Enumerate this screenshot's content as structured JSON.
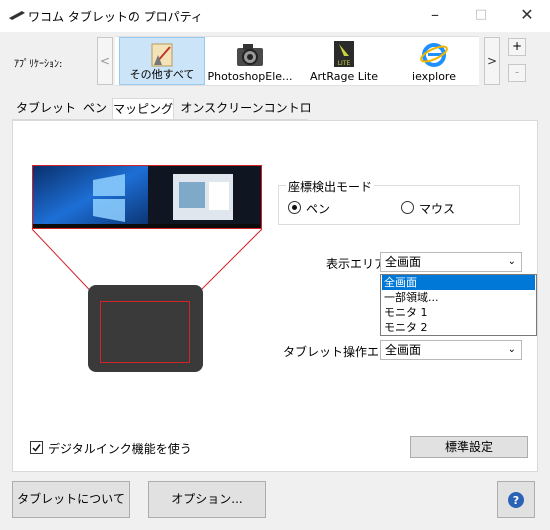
{
  "window": {
    "title": "ワコム タブレットの プロパティ"
  },
  "controls": {
    "minimize": "–",
    "maximize": "□",
    "close": "✕"
  },
  "apps": {
    "label": "ｱﾌﾟﾘｹｰｼｮﾝ:",
    "prev": "<",
    "next": ">",
    "add": "+",
    "remove": "-",
    "items": [
      {
        "label": "その他すべて",
        "icon": "all-apps-icon",
        "selected": true
      },
      {
        "label": "PhotoshopEle...",
        "icon": "photoshop-elements-icon",
        "selected": false
      },
      {
        "label": "ArtRage Lite",
        "icon": "artrage-lite-icon",
        "selected": false
      },
      {
        "label": "iexplore",
        "icon": "internet-explorer-icon",
        "selected": false
      }
    ]
  },
  "tabs": [
    {
      "label": "タブレット",
      "active": false
    },
    {
      "label": "ペン",
      "active": false
    },
    {
      "label": "マッピング",
      "active": true
    },
    {
      "label": "オンスクリーンコントロール",
      "active": false
    }
  ],
  "mapping": {
    "mode_group": {
      "title": "座標検出モード",
      "options": [
        {
          "label": "ペン",
          "checked": true
        },
        {
          "label": "マウス",
          "checked": false
        }
      ]
    },
    "display_area": {
      "label": "表示エリア:",
      "value": "全画面",
      "options": [
        "全画面",
        "一部領域...",
        "モニタ 1",
        "モニタ 2"
      ],
      "highlighted": "全画面"
    },
    "tablet_area": {
      "label": "タブレット操作エリア:",
      "value": "全画面"
    },
    "digital_ink": {
      "label": "デジタルインク機能を使う",
      "checked": true
    },
    "defaults_button": "標準設定"
  },
  "footer": {
    "about": "タブレットについて",
    "options": "オプション...",
    "help_icon": "help-icon"
  },
  "colors": {
    "accent": "#0078d7",
    "map_outline": "#d1232a",
    "selection": "#cce4f7"
  }
}
